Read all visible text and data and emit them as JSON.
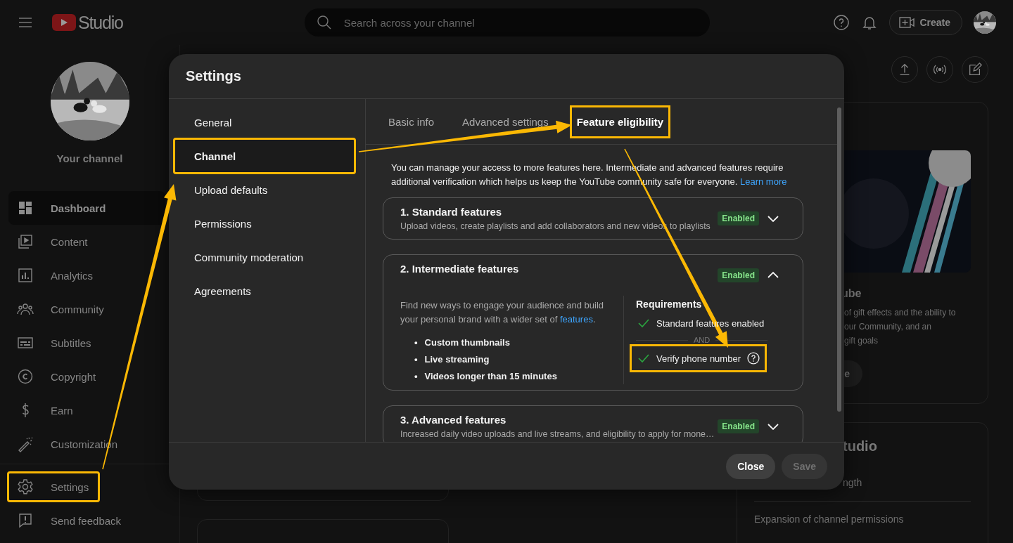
{
  "header": {
    "logo_text": "Studio",
    "search": {
      "placeholder": "Search across your channel"
    },
    "create_button": "Create"
  },
  "sidebar": {
    "channel_title": "Your channel",
    "items": [
      {
        "label": "Dashboard",
        "selected": true
      },
      {
        "label": "Content",
        "selected": false
      },
      {
        "label": "Analytics",
        "selected": false
      },
      {
        "label": "Community",
        "selected": false
      },
      {
        "label": "Subtitles",
        "selected": false
      },
      {
        "label": "Copyright",
        "selected": false
      },
      {
        "label": "Earn",
        "selected": false
      },
      {
        "label": "Customization",
        "selected": false
      }
    ],
    "footer_items": [
      {
        "label": "Settings",
        "highlighted": true
      },
      {
        "label": "Send feedback",
        "highlighted": false
      }
    ]
  },
  "background": {
    "promo_card": {
      "title": "ube",
      "lines": [
        "of gift effects and the ability to",
        "our Community, and an",
        "gift goals"
      ],
      "button": "e"
    },
    "news_card": {
      "title": "tudio",
      "lines": [
        "ngth",
        "Expansion of channel permissions"
      ]
    }
  },
  "settings_dialog": {
    "title": "Settings",
    "nav": [
      {
        "label": "General",
        "selected": false,
        "highlighted": false
      },
      {
        "label": "Channel",
        "selected": true,
        "highlighted": true
      },
      {
        "label": "Upload defaults",
        "selected": false,
        "highlighted": false
      },
      {
        "label": "Permissions",
        "selected": false,
        "highlighted": false
      },
      {
        "label": "Community moderation",
        "selected": false,
        "highlighted": false
      },
      {
        "label": "Agreements",
        "selected": false,
        "highlighted": false
      }
    ],
    "tabs": [
      {
        "label": "Basic info",
        "selected": false,
        "highlighted": false
      },
      {
        "label": "Advanced settings",
        "selected": false,
        "highlighted": false
      },
      {
        "label": "Feature eligibility",
        "selected": true,
        "highlighted": true
      }
    ],
    "intro": "You can manage your access to more features here. Intermediate and advanced features require additional verification which helps us keep the YouTube community safe for everyone.",
    "intro_link": "Learn more",
    "features": [
      {
        "title": "1. Standard features",
        "subtitle": "Upload videos, create playlists and add collaborators and new videos to playlists",
        "status": "Enabled",
        "expanded": false
      },
      {
        "title": "2. Intermediate features",
        "status": "Enabled",
        "expanded": true,
        "description": "Find new ways to engage your audience and build your personal brand with a wider set of",
        "description_link": "features",
        "description_end": ".",
        "perk_marker": "•",
        "perks": [
          "Custom thumbnails",
          "Live streaming",
          "Videos longer than 15 minutes"
        ],
        "requirements_title": "Requirements",
        "separator": "AND",
        "requirements": [
          {
            "label": "Standard features enabled",
            "met": true,
            "help": false,
            "highlighted": false
          },
          {
            "label": "Verify phone number",
            "met": true,
            "help": true,
            "highlighted": true
          }
        ]
      },
      {
        "title": "3. Advanced features",
        "subtitle": "Increased daily video uploads and live streams, and eligibility to apply for mone…",
        "status": "Enabled",
        "expanded": false
      }
    ],
    "buttons": [
      {
        "label": "Close",
        "disabled": false
      },
      {
        "label": "Save",
        "disabled": true
      }
    ]
  }
}
